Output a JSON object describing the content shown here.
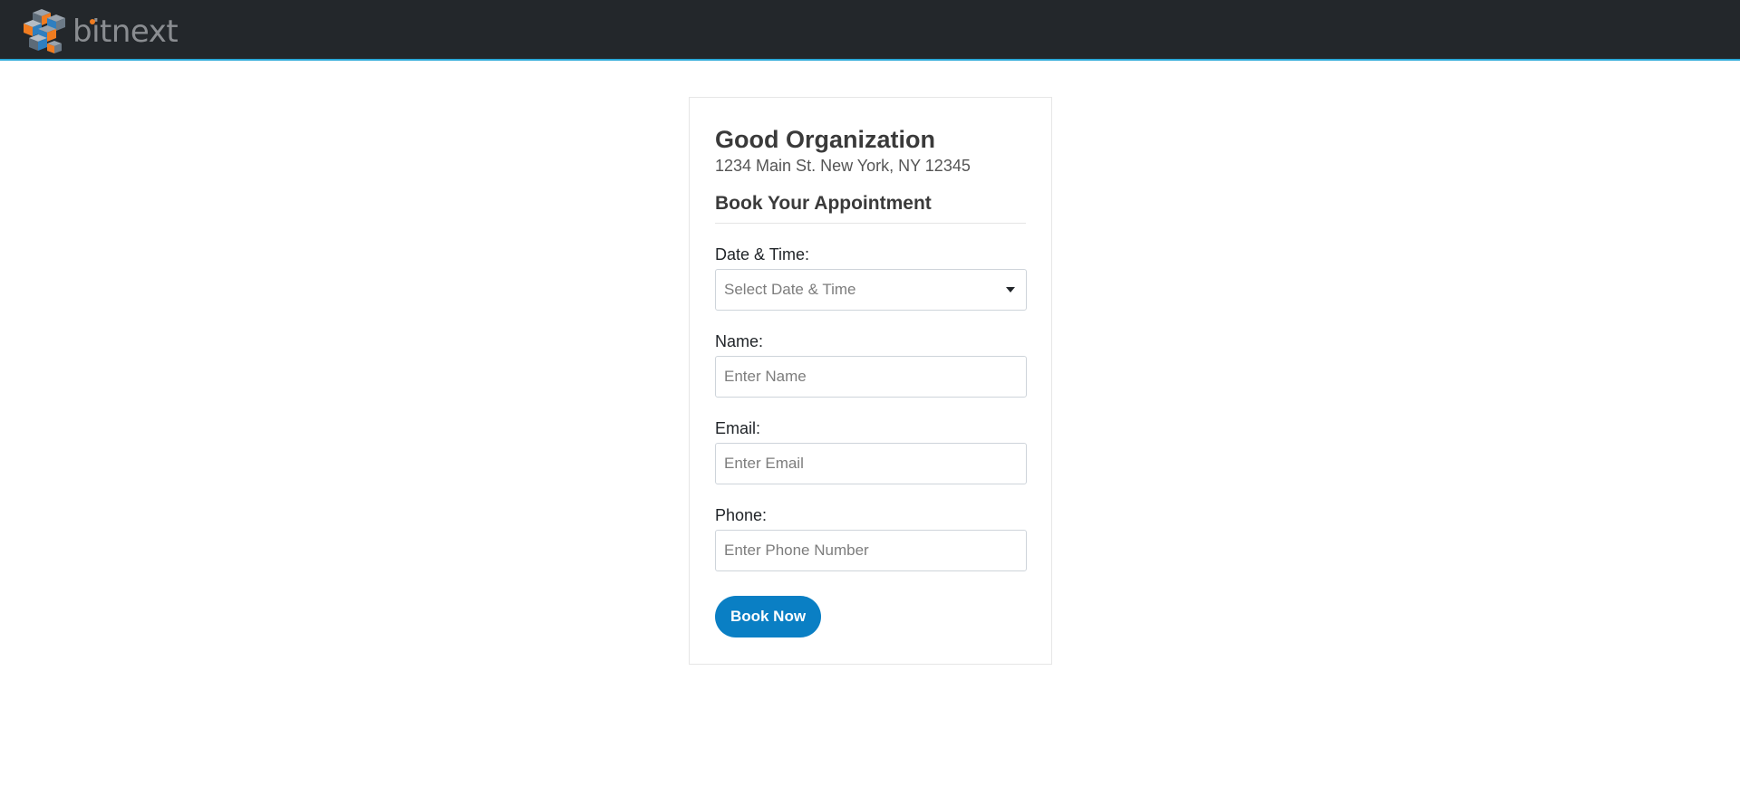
{
  "header": {
    "logo_text": "bitnext"
  },
  "card": {
    "org_name": "Good Organization",
    "org_address": "1234 Main St. New York, NY 12345",
    "section_title": "Book Your Appointment"
  },
  "form": {
    "datetime": {
      "label": "Date & Time:",
      "placeholder": "Select Date & Time"
    },
    "name": {
      "label": "Name:",
      "placeholder": "Enter Name"
    },
    "email": {
      "label": "Email:",
      "placeholder": "Enter Email"
    },
    "phone": {
      "label": "Phone:",
      "placeholder": "Enter Phone Number"
    },
    "submit_label": "Book Now"
  },
  "colors": {
    "header_bg": "#23272b",
    "header_accent": "#2aa8d8",
    "brand_orange": "#f07c20",
    "button_bg": "#0a7fc4"
  },
  "icons": {
    "logo": "bitnext-cube-logo-icon",
    "dropdown": "caret-down-icon"
  }
}
